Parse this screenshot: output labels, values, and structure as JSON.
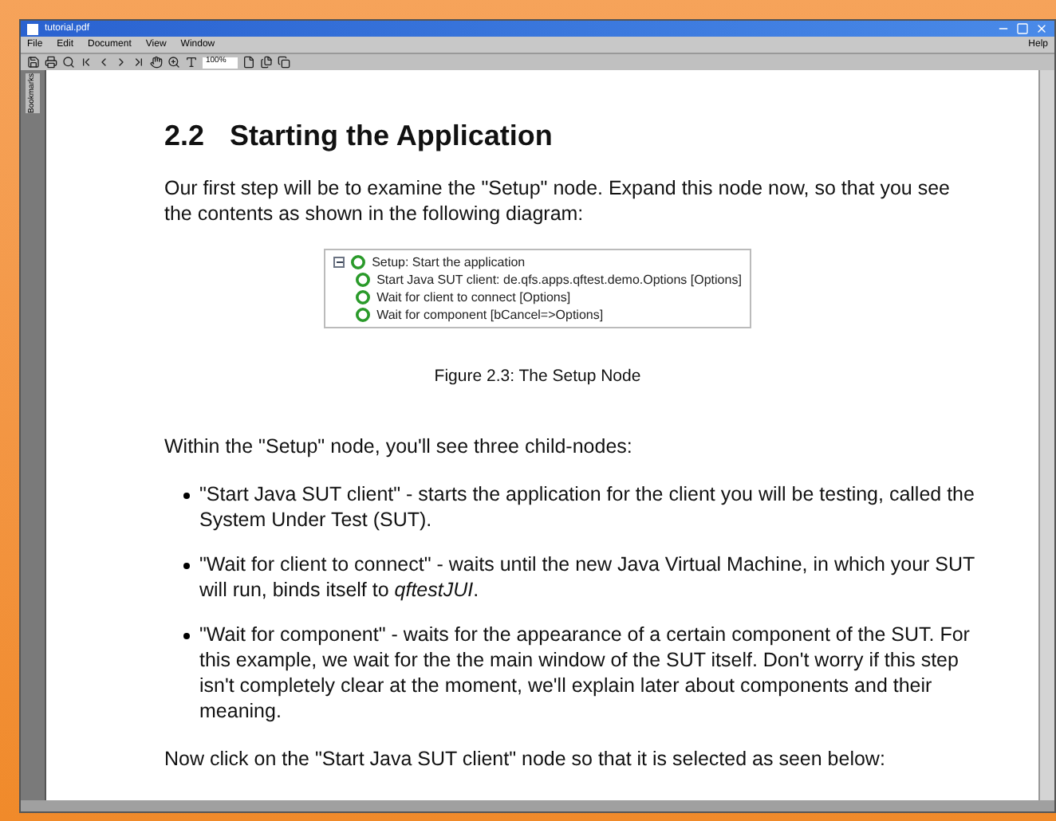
{
  "window": {
    "title": "tutorial.pdf"
  },
  "menu": {
    "left": [
      "File",
      "Edit",
      "Document",
      "View",
      "Window"
    ],
    "right": "Help"
  },
  "toolbar": {
    "zoom": "100%"
  },
  "side_tab": "Bookmarks",
  "page": {
    "heading_number": "2.2",
    "heading": "Starting the Application",
    "intro": "Our first step will be to examine the \"Setup\" node.  Expand this node now, so that you see the contents as shown in the following diagram:",
    "figure": {
      "tree": [
        {
          "label": "Setup: Start the application",
          "expanded": true,
          "children": [
            {
              "label": "Start Java SUT client: de.qfs.apps.qftest.demo.Options [Options]"
            },
            {
              "label": "Wait for client to connect [Options]"
            },
            {
              "label": "Wait for component [bCancel=>Options]"
            }
          ]
        }
      ],
      "caption": "Figure 2.3: The Setup Node"
    },
    "lead": "Within the \"Setup\" node, you'll see three child-nodes:",
    "bullets": [
      "\"Start Java SUT client\" - starts the application for the client you will be testing, called the System Under Test (SUT).",
      "\"Wait for client to connect\" - waits until the new Java Virtual Machine, in which your SUT will run, binds itself to *qftestJUI*.",
      "\"Wait for component\" - waits for the appearance of a certain component of the SUT. For this example, we wait for the the main window of the SUT itself.  Don't worry if this step isn't completely clear at the moment, we'll explain later about components and their meaning."
    ],
    "closing": "Now click on the \"Start Java SUT client\" node so that it is selected as seen below:"
  }
}
